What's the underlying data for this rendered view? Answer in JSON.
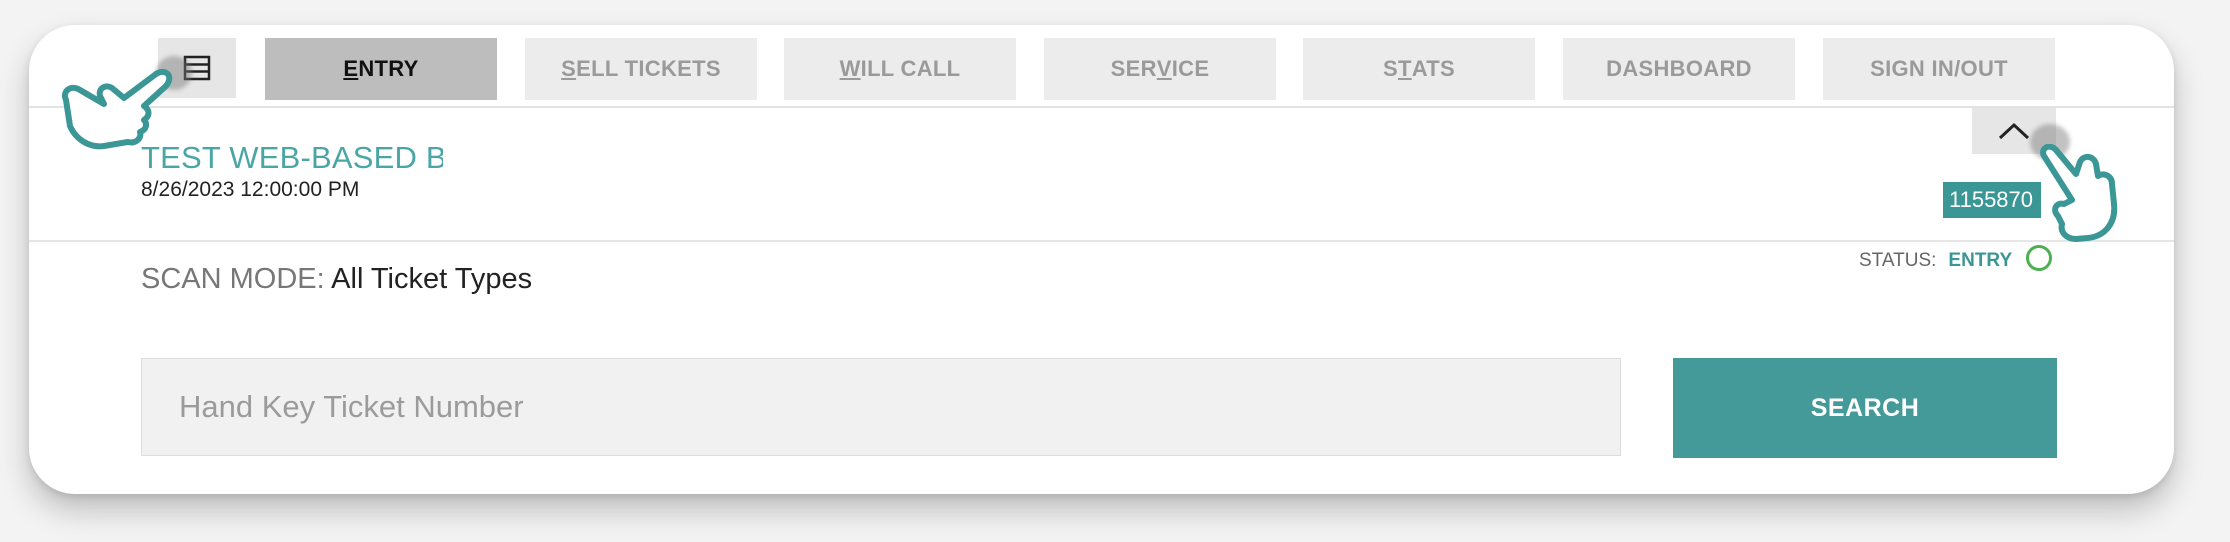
{
  "nav": {
    "tabs": [
      {
        "pre": "",
        "u": "E",
        "post": "NTRY",
        "active": true
      },
      {
        "pre": "",
        "u": "S",
        "post": "ELL TICKETS",
        "active": false
      },
      {
        "pre": "",
        "u": "W",
        "post": "ILL CALL",
        "active": false
      },
      {
        "pre": "SER",
        "u": "V",
        "post": "ICE",
        "active": false
      },
      {
        "pre": "S",
        "u": "T",
        "post": "ATS",
        "active": false
      },
      {
        "pre": "DASHBOARD",
        "u": "",
        "post": "",
        "active": false
      },
      {
        "pre": "SIGN IN/OUT",
        "u": "",
        "post": "",
        "active": false
      }
    ],
    "menu_icon": "list-menu-icon"
  },
  "event": {
    "title": "TEST WEB-BASED BOX OFFICE",
    "date": "8/26/2023 12:00:00 PM",
    "id": "1155870",
    "collapse_icon": "chevron-up-icon"
  },
  "scan": {
    "label": "SCAN MODE:",
    "value": "All Ticket Types"
  },
  "status": {
    "label": "STATUS:",
    "value": "ENTRY"
  },
  "search": {
    "placeholder": "Hand Key Ticket Number",
    "value": "",
    "button_label": "SEARCH"
  },
  "colors": {
    "accent": "#449999",
    "title": "#4aa6a6",
    "status_ring": "#4caf50",
    "hand_stroke": "#3b9696"
  }
}
